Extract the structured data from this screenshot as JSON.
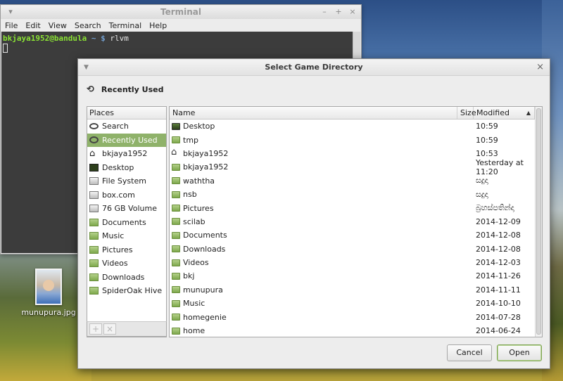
{
  "desktop": {
    "icon_label": "munupura.jpg"
  },
  "terminal": {
    "title": "Terminal",
    "window_controls": [
      "▾",
      "–",
      "+",
      "×"
    ],
    "menu": [
      "File",
      "Edit",
      "View",
      "Search",
      "Terminal",
      "Help"
    ],
    "prompt_user": "bkjaya1952@bandula",
    "prompt_path": "~ $",
    "command": "rlvm"
  },
  "dialog": {
    "title": "Select Game Directory",
    "location": "Recently Used",
    "places_header": "Places",
    "places": [
      {
        "label": "Search",
        "icon": "search-icon"
      },
      {
        "label": "Recently Used",
        "icon": "recent-icon",
        "active": true
      },
      {
        "label": "bkjaya1952",
        "icon": "home-icon"
      },
      {
        "label": "Desktop",
        "icon": "desktop-icon"
      },
      {
        "label": "File System",
        "icon": "drive-icon"
      },
      {
        "label": "box.com",
        "icon": "drive-icon"
      },
      {
        "label": "76 GB Volume",
        "icon": "drive-icon"
      },
      {
        "label": "Documents",
        "icon": "folder-icon"
      },
      {
        "label": "Music",
        "icon": "music-folder-icon"
      },
      {
        "label": "Pictures",
        "icon": "pictures-folder-icon"
      },
      {
        "label": "Videos",
        "icon": "videos-folder-icon"
      },
      {
        "label": "Downloads",
        "icon": "downloads-folder-icon"
      },
      {
        "label": "SpiderOak Hive",
        "icon": "folder-icon"
      }
    ],
    "columns": {
      "name": "Name",
      "size": "Size",
      "modified": "Modified"
    },
    "files": [
      {
        "name": "Desktop",
        "modified": "10:59",
        "icon": "desktop-folder-icon"
      },
      {
        "name": "tmp",
        "modified": "10:59",
        "icon": "folder-icon"
      },
      {
        "name": "bkjaya1952",
        "modified": "10:53",
        "icon": "home-icon"
      },
      {
        "name": "bkjaya1952",
        "modified": "Yesterday at 11:20",
        "icon": "folder-icon"
      },
      {
        "name": "waththa",
        "modified": "සදුදා",
        "icon": "folder-icon"
      },
      {
        "name": "nsb",
        "modified": "සදුදා",
        "icon": "folder-icon"
      },
      {
        "name": "Pictures",
        "modified": "බ්‍රහස්පතින්දා",
        "icon": "pictures-folder-icon"
      },
      {
        "name": "scilab",
        "modified": "2014-12-09",
        "icon": "folder-icon"
      },
      {
        "name": "Documents",
        "modified": "2014-12-08",
        "icon": "folder-icon"
      },
      {
        "name": "Downloads",
        "modified": "2014-12-08",
        "icon": "downloads-folder-icon"
      },
      {
        "name": "Videos",
        "modified": "2014-12-03",
        "icon": "videos-folder-icon"
      },
      {
        "name": "bkj",
        "modified": "2014-11-26",
        "icon": "folder-icon"
      },
      {
        "name": "munupura",
        "modified": "2014-11-11",
        "icon": "folder-icon"
      },
      {
        "name": "Music",
        "modified": "2014-10-10",
        "icon": "music-folder-icon"
      },
      {
        "name": "homegenie",
        "modified": "2014-07-28",
        "icon": "folder-icon"
      },
      {
        "name": "home",
        "modified": "2014-06-24",
        "icon": "folder-icon"
      }
    ],
    "buttons": {
      "cancel": "Cancel",
      "open": "Open"
    }
  }
}
